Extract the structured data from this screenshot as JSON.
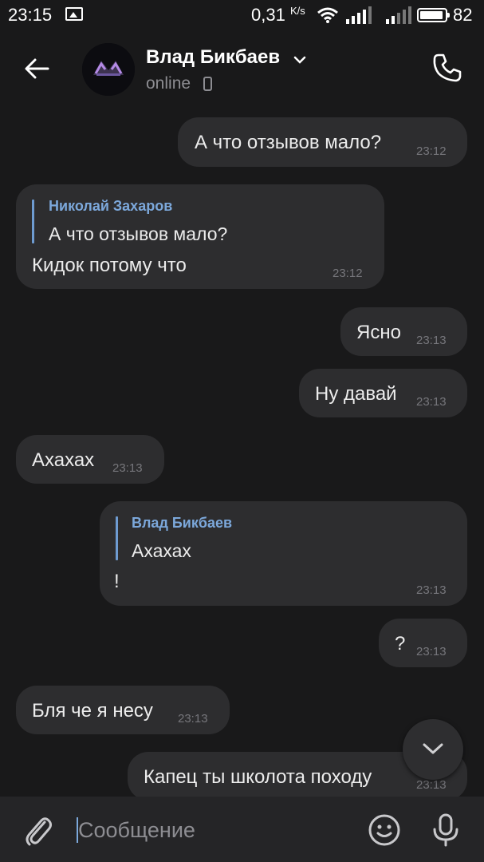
{
  "status_bar": {
    "time": "23:15",
    "net_speed": "0,31",
    "net_unit": "K/s",
    "battery": "82"
  },
  "header": {
    "contact_name": "Влад Бикбаев",
    "status": "online"
  },
  "messages": [
    {
      "side": "out",
      "text": "А что отзывов мало?",
      "time": "23:12"
    },
    {
      "side": "in",
      "reply_author": "Николай Захаров",
      "reply_text": "А что отзывов мало?",
      "text": "Кидок потому что",
      "time": "23:12"
    },
    {
      "side": "out",
      "text": "Ясно",
      "time": "23:13"
    },
    {
      "side": "out",
      "text": "Ну давай",
      "time": "23:13"
    },
    {
      "side": "in",
      "text": "Ахахах",
      "time": "23:13"
    },
    {
      "side": "out",
      "reply_author": "Влад Бикбаев",
      "reply_text": "Ахахах",
      "text": "!",
      "time": "23:13"
    },
    {
      "side": "out",
      "text": "?",
      "time": "23:13"
    },
    {
      "side": "in",
      "text": "Бля че я несу",
      "time": "23:13"
    },
    {
      "side": "out",
      "text": "Капец ты школота походу",
      "time": "23:13"
    }
  ],
  "composer": {
    "placeholder": "Сообщение"
  },
  "colors": {
    "background": "#19191a",
    "bubble": "#2d2d2f",
    "accent": "#7ca8db"
  },
  "icons": [
    "back-arrow-icon",
    "chevron-down-icon",
    "mobile-phone-icon",
    "call-icon",
    "scroll-down-icon",
    "attach-icon",
    "emoji-icon",
    "microphone-icon"
  ]
}
